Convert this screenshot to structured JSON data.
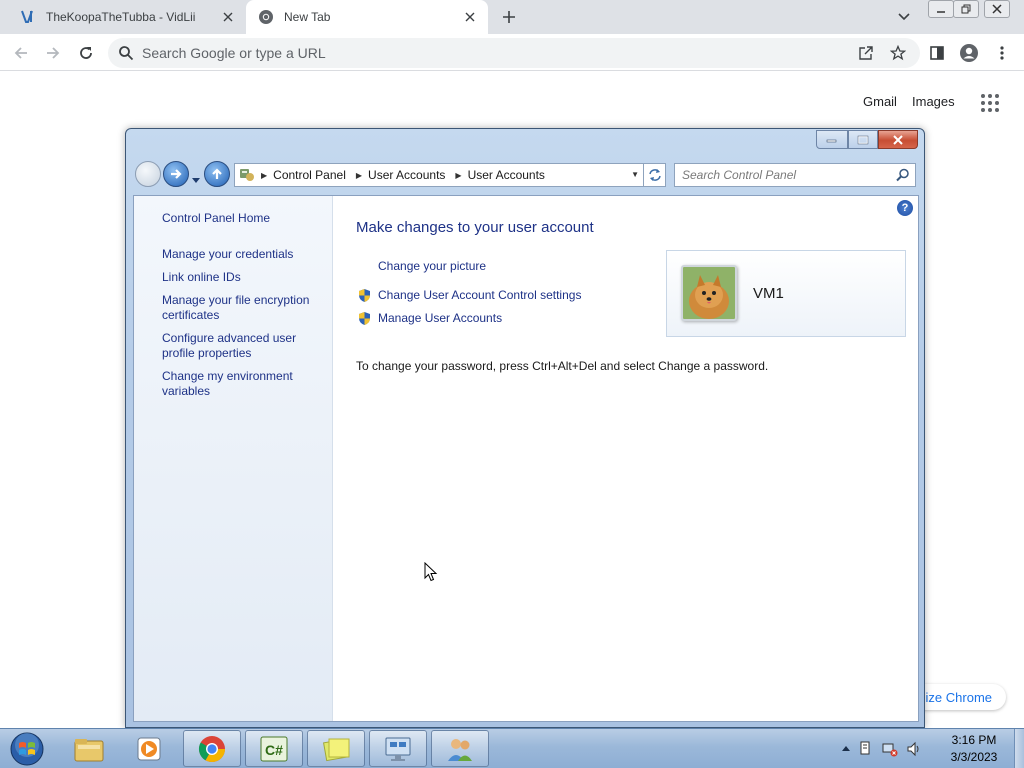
{
  "browser": {
    "tabs": [
      {
        "title": "TheKoopaTheTubba - VidLii",
        "icon": "vidlii-icon",
        "active": false
      },
      {
        "title": "New Tab",
        "icon": "chrome-icon",
        "active": true
      }
    ],
    "omnibox_placeholder": "Search Google or type a URL",
    "ntp": {
      "gmail": "Gmail",
      "images": "Images",
      "customize_partial": "ize Chrome"
    }
  },
  "window": {
    "breadcrumbs": [
      "Control Panel",
      "User Accounts",
      "User Accounts"
    ],
    "search_placeholder": "Search Control Panel",
    "help_label": "?",
    "sidebar": {
      "home": "Control Panel Home",
      "links": [
        "Manage your credentials",
        "Link online IDs",
        "Manage your file encryption certificates",
        "Configure advanced user profile properties",
        "Change my environment variables"
      ]
    },
    "main": {
      "title": "Make changes to your user account",
      "tasks": [
        {
          "label": "Change your picture",
          "shield": false
        },
        {
          "label": "Change User Account Control settings",
          "shield": true
        },
        {
          "label": "Manage User Accounts",
          "shield": true
        }
      ],
      "password_note": "To change your password, press Ctrl+Alt+Del and select Change a password.",
      "user": {
        "name": "VM1"
      }
    }
  },
  "taskbar": {
    "apps": [
      "windows-explorer-icon",
      "media-player-icon",
      "chrome-icon",
      "csharp-icon",
      "sticky-notes-icon",
      "remote-desktop-icon",
      "user-accounts-icon"
    ],
    "clock": {
      "time": "3:16 PM",
      "date": "3/3/2023"
    }
  },
  "colors": {
    "link": "#1e3287",
    "chrome_accent": "#1a73e8",
    "taskbar": "#9bb8d9"
  }
}
